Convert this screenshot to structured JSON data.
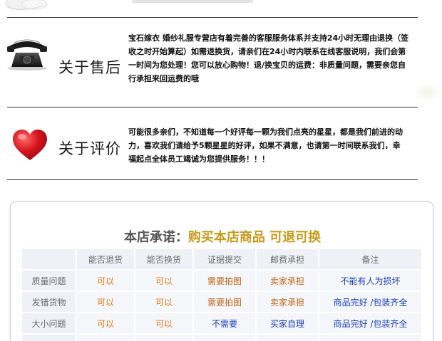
{
  "after_sales": {
    "title": "关于售后",
    "lines": [
      "宝石嫁衣 婚纱礼服专营店有着完善的客服服务体系并支持24小时无理由退换（签",
      "收之时开始算起）如需退换货，请亲们在24小时内联系在线客服说明，我们会第",
      "一时间为您处理！您可以放心购物！退/换宝贝的运费：非质量问题，需要亲您自",
      "行承担来回运费的哦"
    ]
  },
  "review": {
    "title": "关于评价",
    "lines": [
      "可能很多亲们，不知道每一个好评每一颗为我们点亮的星星，都是我们前进的动",
      "力，喜欢我们请给予5颗星星的好评，如果不满意，也请第一时间联系我们，幸",
      "福起点全体员工竭诚为您提供服务！！！"
    ]
  },
  "promise": {
    "title_prefix": "本店承诺：",
    "title_highlight": "购买本店商品 可退可换",
    "headers": [
      "",
      "能否退货",
      "能否换货",
      "证据提交",
      "邮费承担",
      "备注"
    ],
    "rows": [
      {
        "label": "质量问题",
        "cells": [
          "可以",
          "可以",
          "需要拍图",
          "卖家承担",
          "不能有人为损坏"
        ]
      },
      {
        "label": "发错货物",
        "cells": [
          "可以",
          "可以",
          "需要拍图",
          "卖家承担",
          "商品完好 /包装齐全"
        ]
      },
      {
        "label": "大小问题",
        "cells": [
          "可以",
          "可以",
          "不需要",
          "买家自理",
          "商品完好 /包装齐全"
        ]
      }
    ]
  },
  "colors": {
    "accent_gold": "#c89a1a",
    "orange": "#e07a10",
    "blue": "#1a3fb8",
    "brown": "#c0661a",
    "heart_red": "#d8141e"
  },
  "icons": {
    "phone": "telephone-icon",
    "heart": "heart-icon"
  }
}
